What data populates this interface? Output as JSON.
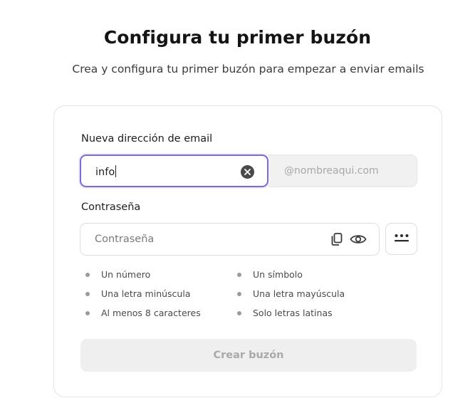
{
  "header": {
    "title": "Configura tu primer buzón",
    "subtitle": "Crea y configura tu primer buzón para empezar a enviar emails"
  },
  "form": {
    "email_label": "Nueva dirección de email",
    "email_value": "info",
    "domain_suffix": "@nombreaqui.com",
    "password_label": "Contraseña",
    "password_placeholder": "Contraseña",
    "password_value": "",
    "requirements": [
      {
        "text": "Un número"
      },
      {
        "text": "Un símbolo"
      },
      {
        "text": "Una letra minúscula"
      },
      {
        "text": "Una letra mayúscula"
      },
      {
        "text": "Al menos 8 caracteres"
      },
      {
        "text": "Solo letras latinas"
      }
    ],
    "submit_label": "Crear buzón"
  },
  "icons": {
    "clear": "clear-icon",
    "copy": "copy-icon",
    "visibility": "eye-icon",
    "generate_password": "password-dots-icon"
  },
  "colors": {
    "focus_border": "#7b6bd6",
    "disabled_button_bg": "#efefef",
    "disabled_button_text": "#a9a9a9",
    "bullet": "#9b9b9b"
  }
}
